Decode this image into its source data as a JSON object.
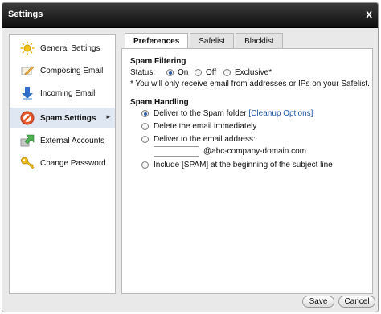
{
  "window": {
    "title": "Settings",
    "close_glyph": "x"
  },
  "sidebar": {
    "items": [
      {
        "label": "General Settings",
        "icon": "sun-icon",
        "active": false
      },
      {
        "label": "Composing Email",
        "icon": "compose-icon",
        "active": false
      },
      {
        "label": "Incoming Email",
        "icon": "incoming-arrow-icon",
        "active": false
      },
      {
        "label": "Spam Settings",
        "icon": "no-entry-icon",
        "active": true
      },
      {
        "label": "External Accounts",
        "icon": "external-arrow-icon",
        "active": false
      },
      {
        "label": "Change Password",
        "icon": "key-icon",
        "active": false
      }
    ]
  },
  "tabs": [
    {
      "label": "Preferences",
      "active": true
    },
    {
      "label": "Safelist",
      "active": false
    },
    {
      "label": "Blacklist",
      "active": false
    }
  ],
  "spam_filtering": {
    "title": "Spam Filtering",
    "status_label": "Status:",
    "options": [
      {
        "label": "On",
        "checked": true
      },
      {
        "label": "Off",
        "checked": false
      },
      {
        "label": "Exclusive*",
        "checked": false
      }
    ],
    "note": "* You will only receive email from addresses or IPs on your Safelist."
  },
  "spam_handling": {
    "title": "Spam Handling",
    "options": [
      {
        "label": "Deliver to the Spam folder",
        "link": "[Cleanup Options]",
        "checked": true
      },
      {
        "label": "Delete the email immediately",
        "checked": false
      },
      {
        "label": "Deliver to the email address:",
        "checked": false
      },
      {
        "label": "Include [SPAM] at the beginning of the subject line",
        "checked": false
      }
    ],
    "address_value": "",
    "domain_suffix": "@abc-company-domain.com"
  },
  "buttons": {
    "save": "Save",
    "cancel": "Cancel"
  },
  "colors": {
    "titlebar": "#1a1a1a",
    "active_item_bg": "#dfe8f2",
    "radio_dot": "#2c5ea8",
    "link": "#2457a5"
  }
}
